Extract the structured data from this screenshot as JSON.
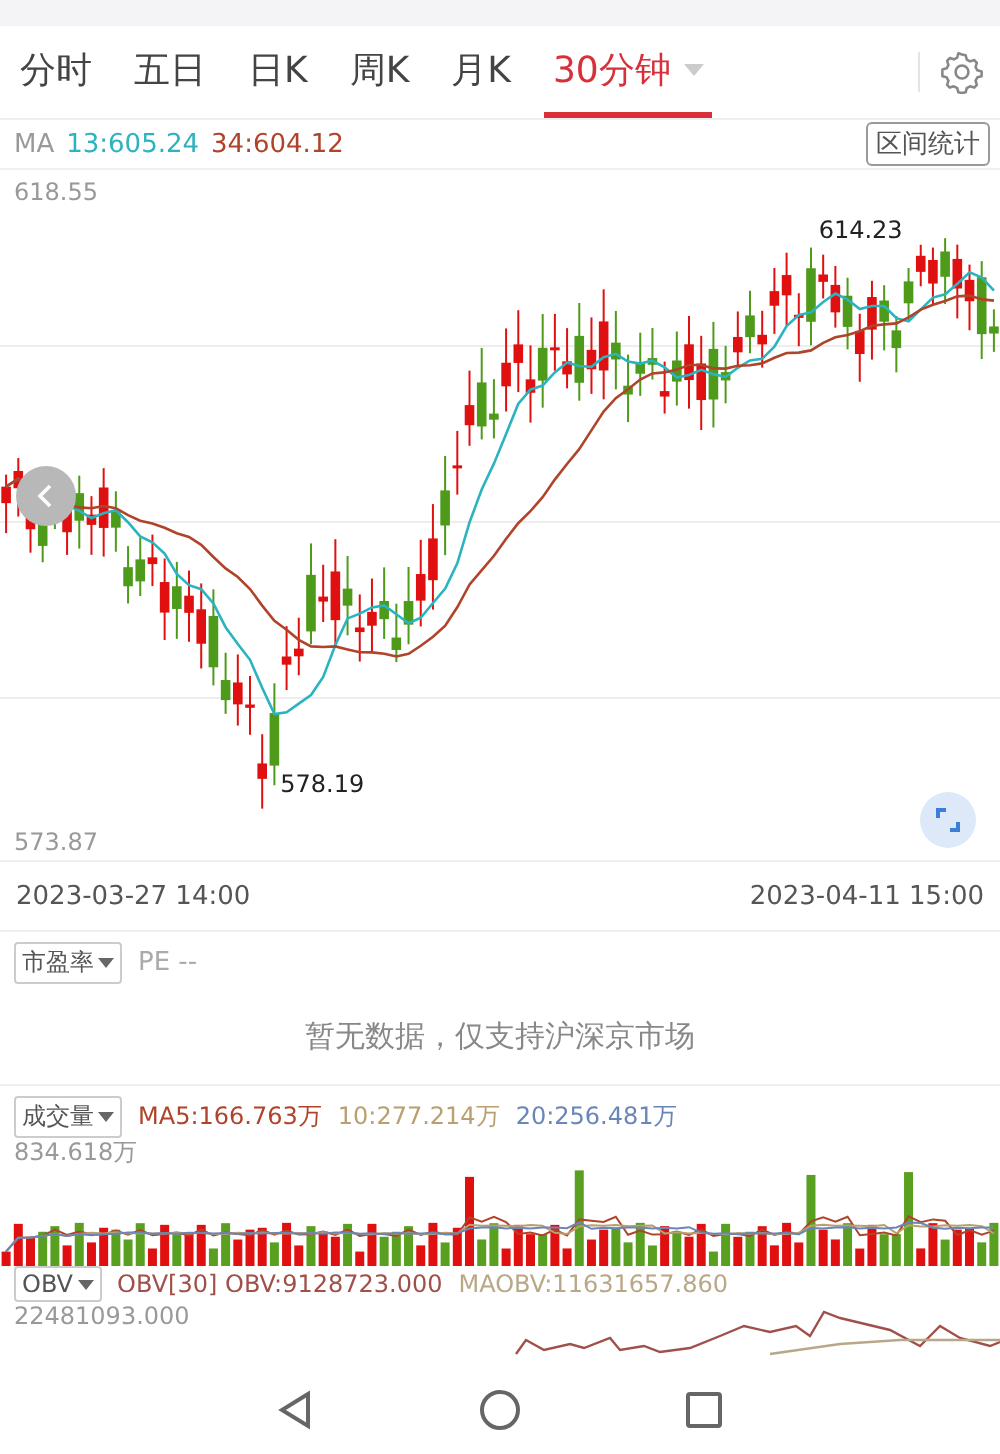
{
  "tabs": [
    {
      "label": "分时",
      "selected": false,
      "has_menu": false
    },
    {
      "label": "五日",
      "selected": false,
      "has_menu": false
    },
    {
      "label": "日K",
      "selected": false,
      "has_menu": false
    },
    {
      "label": "周K",
      "selected": false,
      "has_menu": false
    },
    {
      "label": "月K",
      "selected": false,
      "has_menu": false
    },
    {
      "label": "30分钟",
      "selected": true,
      "has_menu": true
    }
  ],
  "ma_legend": {
    "label": "MA",
    "items": [
      {
        "text": "13:605.24",
        "color": "#2bb3c0"
      },
      {
        "text": "34:604.12",
        "color": "#b0442a"
      }
    ]
  },
  "range_button": "区间统计",
  "price_chart": {
    "top_label": "618.55",
    "bottom_label": "573.87",
    "high_marker": "614.23",
    "low_marker": "578.19",
    "start_time": "2023-03-27  14:00",
    "end_time": "2023-04-11  15:00"
  },
  "pe_panel": {
    "selector": "市盈率",
    "value": "PE --",
    "message": "暂无数据，仅支持沪深京市场"
  },
  "volume_panel": {
    "selector": "成交量",
    "items": [
      {
        "text": "MA5:166.763万",
        "color": "#b0442a"
      },
      {
        "text": "10:277.214万",
        "color": "#b8a070"
      },
      {
        "text": "20:256.481万",
        "color": "#6a86b8"
      }
    ],
    "top_label": "834.618万"
  },
  "obv_panel": {
    "selector": "OBV",
    "items": [
      {
        "text": "OBV[30] OBV:9128723.000",
        "color": "#a0504a"
      },
      {
        "text": "MAOBV:11631657.860",
        "color": "#b8a888"
      }
    ],
    "top_label": "22481093.000"
  }
}
